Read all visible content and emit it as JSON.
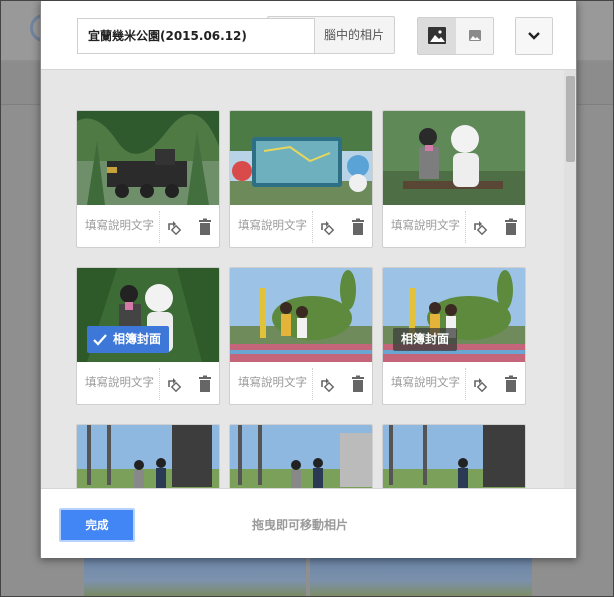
{
  "header": {
    "album_title": "宜蘭幾米公園(2015.06.12)",
    "from_pc_label": "腦中的相片",
    "view_large_icon": "image-large-icon",
    "view_small_icon": "image-small-icon",
    "menu_icon": "chevron-down-icon"
  },
  "photos": [
    {
      "caption": "填寫說明文字",
      "scene": "train"
    },
    {
      "caption": "填寫說明文字",
      "scene": "map-sign"
    },
    {
      "caption": "填寫說明文字",
      "scene": "statue-person"
    },
    {
      "caption": "填寫說明文字",
      "scene": "statue-person-2",
      "cover": true
    },
    {
      "caption": "填寫說明文字",
      "scene": "rabbit"
    },
    {
      "caption": "填寫說明文字",
      "scene": "rabbit-2"
    },
    {
      "caption": "",
      "scene": "plaza"
    },
    {
      "caption": "",
      "scene": "plaza-2"
    },
    {
      "caption": "",
      "scene": "plaza-3"
    }
  ],
  "cover_badge_label": "相簿封面",
  "cover_hover_label": "相簿封面",
  "footer": {
    "done_label": "完成",
    "drag_hint": "拖曳即可移動相片"
  },
  "colors": {
    "accent": "#4285f4",
    "cover_badge": "#3d78d8"
  }
}
